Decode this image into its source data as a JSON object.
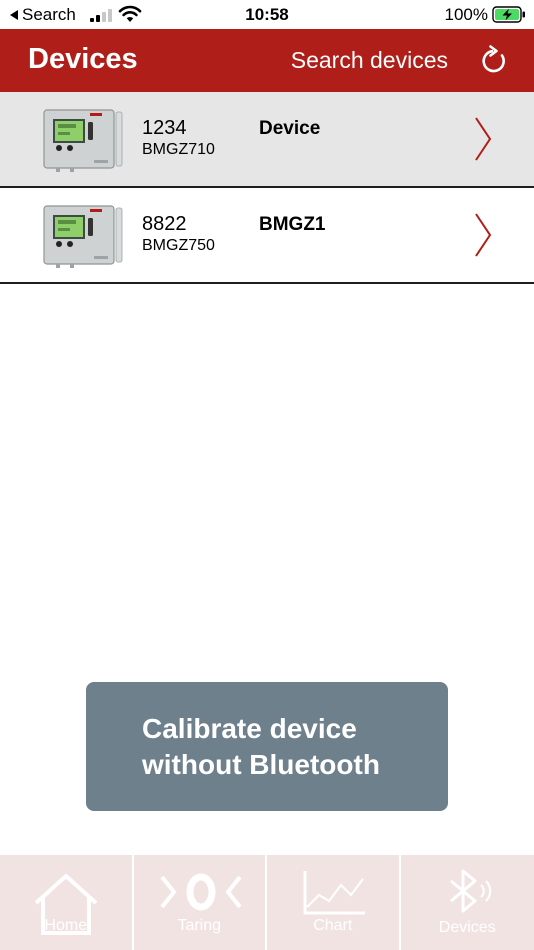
{
  "status_bar": {
    "back_label": "Search",
    "time": "10:58",
    "battery_pct": "100%"
  },
  "header": {
    "title": "Devices",
    "search_label": "Search devices",
    "refresh_icon": "refresh-icon",
    "color": "#b01e1a"
  },
  "devices": [
    {
      "id": "1234",
      "model": "BMGZ710",
      "name": "Device",
      "selected": true
    },
    {
      "id": "8822",
      "model": "BMGZ750",
      "name": "BMGZ1",
      "selected": false
    }
  ],
  "calibrate": {
    "line1": "Calibrate device",
    "line2": "without Bluetooth",
    "color": "#6d808c"
  },
  "tabs": [
    {
      "label": "Home",
      "icon": "home-icon"
    },
    {
      "label": "Taring",
      "icon": "taring-icon"
    },
    {
      "label": "Chart",
      "icon": "chart-icon"
    },
    {
      "label": "Devices",
      "icon": "bluetooth-icon"
    }
  ]
}
